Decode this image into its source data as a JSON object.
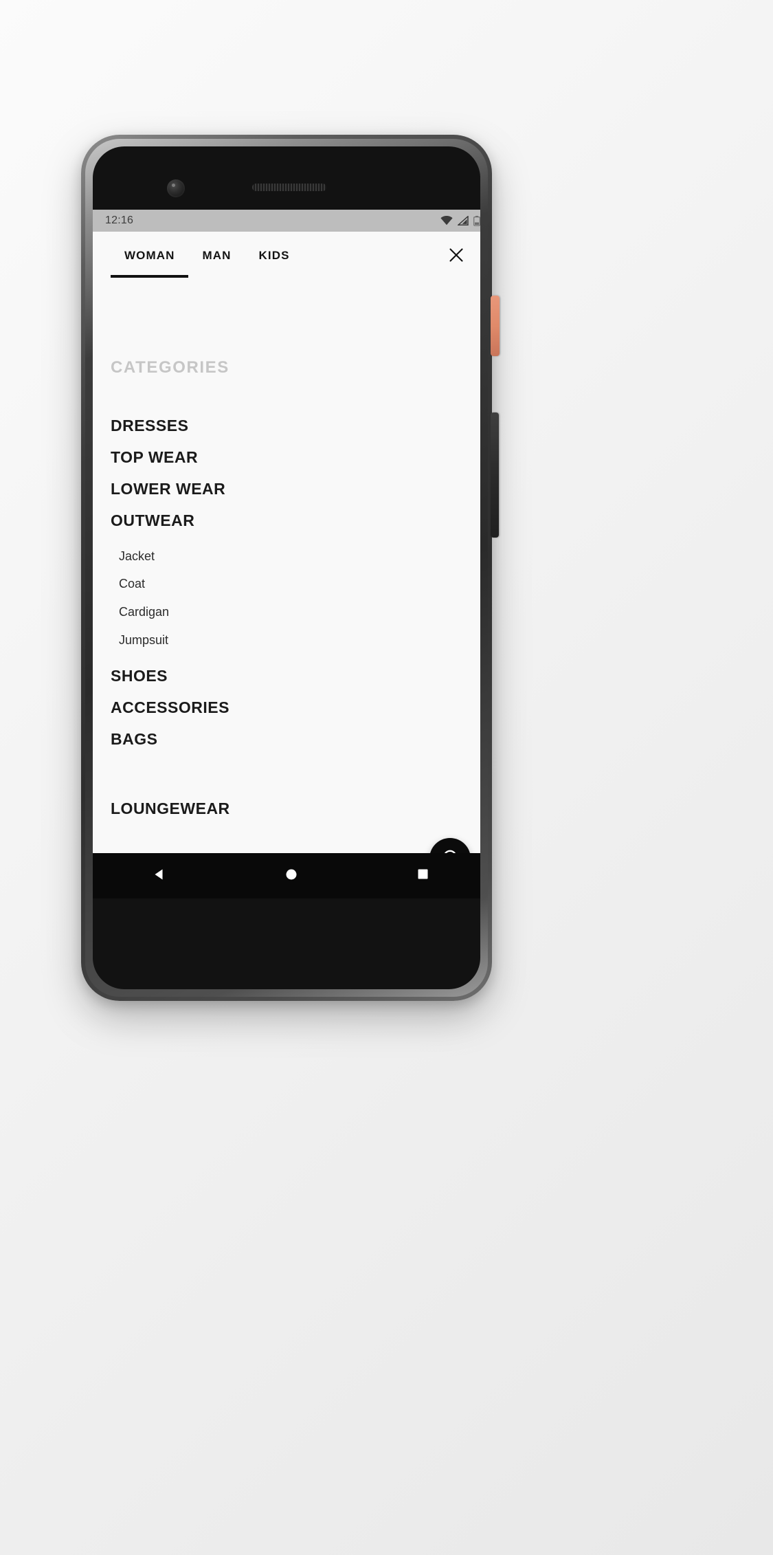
{
  "status_bar": {
    "time": "12:16",
    "icons": [
      "wifi-icon",
      "signal-icon",
      "battery-icon"
    ]
  },
  "app_bar": {
    "tabs": [
      {
        "label": "WOMAN",
        "active": true
      },
      {
        "label": "MAN",
        "active": false
      },
      {
        "label": "KIDS",
        "active": false
      }
    ],
    "close_label": "close-icon"
  },
  "menu": {
    "section_title": "CATEGORIES",
    "categories": [
      {
        "label": "DRESSES",
        "expanded": false,
        "subitems": []
      },
      {
        "label": "TOP WEAR",
        "expanded": false,
        "subitems": []
      },
      {
        "label": "LOWER WEAR",
        "expanded": false,
        "subitems": []
      },
      {
        "label": "OUTWEAR",
        "expanded": true,
        "subitems": [
          "Jacket",
          "Coat",
          "Cardigan",
          "Jumpsuit"
        ]
      },
      {
        "label": "SHOES",
        "expanded": false,
        "subitems": []
      },
      {
        "label": "ACCESSORIES",
        "expanded": false,
        "subitems": []
      },
      {
        "label": "BAGS",
        "expanded": false,
        "subitems": []
      },
      {
        "label": "LOUNGEWEAR",
        "expanded": false,
        "subitems": [],
        "spaced": true
      }
    ]
  },
  "support_fab": {
    "icon": "headset-support-icon"
  },
  "system_nav": {
    "back": "back-triangle-icon",
    "home": "home-circle-icon",
    "recents": "recents-square-icon"
  },
  "colors": {
    "screen_bg": "#f9f9f9",
    "text_primary": "#1b1b1b",
    "text_muted": "#c6c6c6",
    "status_bar_bg": "#bdbdbd",
    "fab_bg": "#0b0b0b",
    "nav_bg": "#090909"
  }
}
